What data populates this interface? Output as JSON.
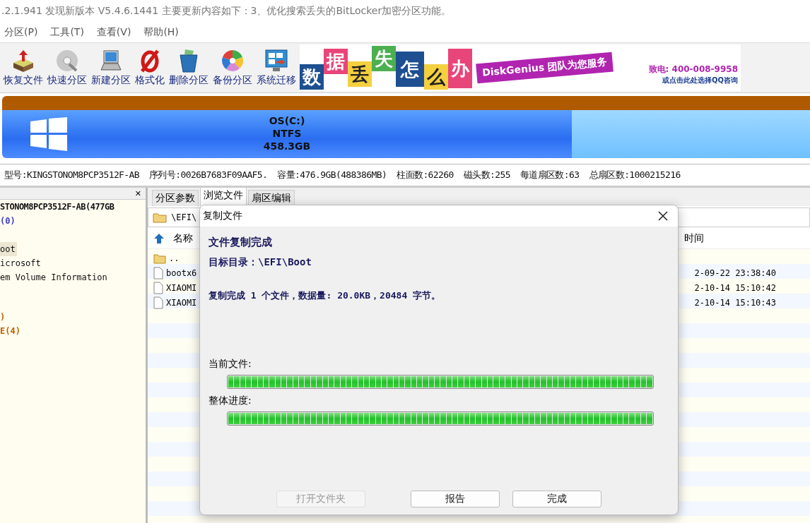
{
  "title_bar": {
    "text": ".2.1.941    发现新版本 V5.4.6.1441 主要更新内容如下：3、优化搜索丢失的BitLocker加密分区功能。"
  },
  "menu": [
    "分区(P)",
    "工具(T)",
    "查看(V)",
    "帮助(H)"
  ],
  "toolbar": [
    {
      "label": "恢复文件",
      "kind": "restore",
      "disabled": false
    },
    {
      "label": "快速分区",
      "kind": "disc",
      "disabled": false
    },
    {
      "label": "新建分区",
      "kind": "laptop",
      "disabled": false
    },
    {
      "label": "格式化",
      "kind": "format",
      "disabled": false
    },
    {
      "label": "删除分区",
      "kind": "trash",
      "disabled": false
    },
    {
      "label": "备份分区",
      "kind": "backup",
      "disabled": false
    },
    {
      "label": "系统迁移",
      "kind": "migrate",
      "disabled": false
    }
  ],
  "banner": {
    "tiles": [
      {
        "text": "数",
        "color": "#1d4f91"
      },
      {
        "text": "据",
        "color": "#e8457a"
      },
      {
        "text": "丢",
        "color": "#f4d03f"
      },
      {
        "text": "失",
        "color": "#4caf50"
      },
      {
        "text": "怎",
        "color": "#1d4f91"
      },
      {
        "text": "么",
        "color": "#f4d03f"
      },
      {
        "text": "办",
        "color": "#e8457a"
      }
    ],
    "slogan": "DiskGenius 团队为您服务",
    "phone": "致电: 400-008-9958",
    "qq": "或点击此处选择QQ咨询"
  },
  "disk_bar": {
    "partition": {
      "name": "OS(C:)",
      "fs": "NTFS",
      "size": "458.3GB"
    }
  },
  "disk_info": [
    "型号:KINGSTONOM8PCP3512F-AB",
    "序列号:0026B7683F09AAF5.",
    "容量:476.9GB(488386MB)",
    "柱面数:62260",
    "磁头数:255",
    "每道扇区数:63",
    "总扇区数:1000215216"
  ],
  "tree_panel": {
    "close": "✕"
  },
  "tree": [
    {
      "text": "STONOM8PCP3512F-AB(477GB",
      "kind": "disk",
      "selected": false
    },
    {
      "text": "(0)",
      "kind": "part",
      "selected": false
    },
    {
      "text": "oot",
      "kind": "folder",
      "selected": true
    },
    {
      "text": "icrosoft",
      "kind": "folder",
      "selected": false
    },
    {
      "text": "em Volume Information",
      "kind": "folder",
      "selected": false
    },
    {
      "text": ")",
      "kind": "part2",
      "selected": false
    },
    {
      "text": "E(4)",
      "kind": "part2",
      "selected": false
    }
  ],
  "tabs": [
    {
      "label": "分区参数",
      "selected": false
    },
    {
      "label": "浏览文件",
      "selected": true
    },
    {
      "label": "扇区编辑",
      "selected": false
    }
  ],
  "path": "\\EFI\\",
  "columns": [
    "名称",
    "时间"
  ],
  "files": [
    {
      "name": "..",
      "kind": "folder"
    },
    {
      "name": "bootx6",
      "kind": "file",
      "time": "2-09-22 23:38:40"
    },
    {
      "name": "XIAOMI",
      "kind": "file",
      "time": "2-10-14 15:10:42"
    },
    {
      "name": "XIAOMI",
      "kind": "file",
      "time": "2-10-14 15:10:43"
    }
  ],
  "dialog": {
    "title": "复制文件",
    "heading": "文件复制完成",
    "target": "目标目录：\\EFI\\Boot",
    "summary": "复制完成 1 个文件，数据量: 20.0KB，20484 字节。",
    "progress": [
      {
        "label": "当前文件:",
        "level": 1
      },
      {
        "label": "整体进度:",
        "level": 1
      }
    ],
    "buttons": [
      {
        "label": "打开文件夹",
        "disabled": true
      },
      {
        "label": "报告",
        "disabled": false
      },
      {
        "label": "完成",
        "disabled": false
      }
    ]
  }
}
